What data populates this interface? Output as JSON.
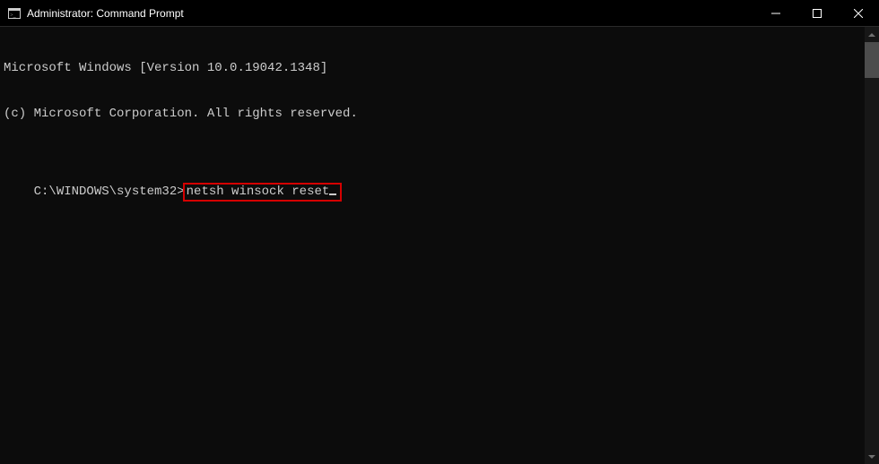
{
  "titlebar": {
    "title": "Administrator: Command Prompt"
  },
  "console": {
    "line1": "Microsoft Windows [Version 10.0.19042.1348]",
    "line2": "(c) Microsoft Corporation. All rights reserved.",
    "prompt_path": "C:\\WINDOWS\\system32>",
    "command": "netsh winsock reset"
  }
}
